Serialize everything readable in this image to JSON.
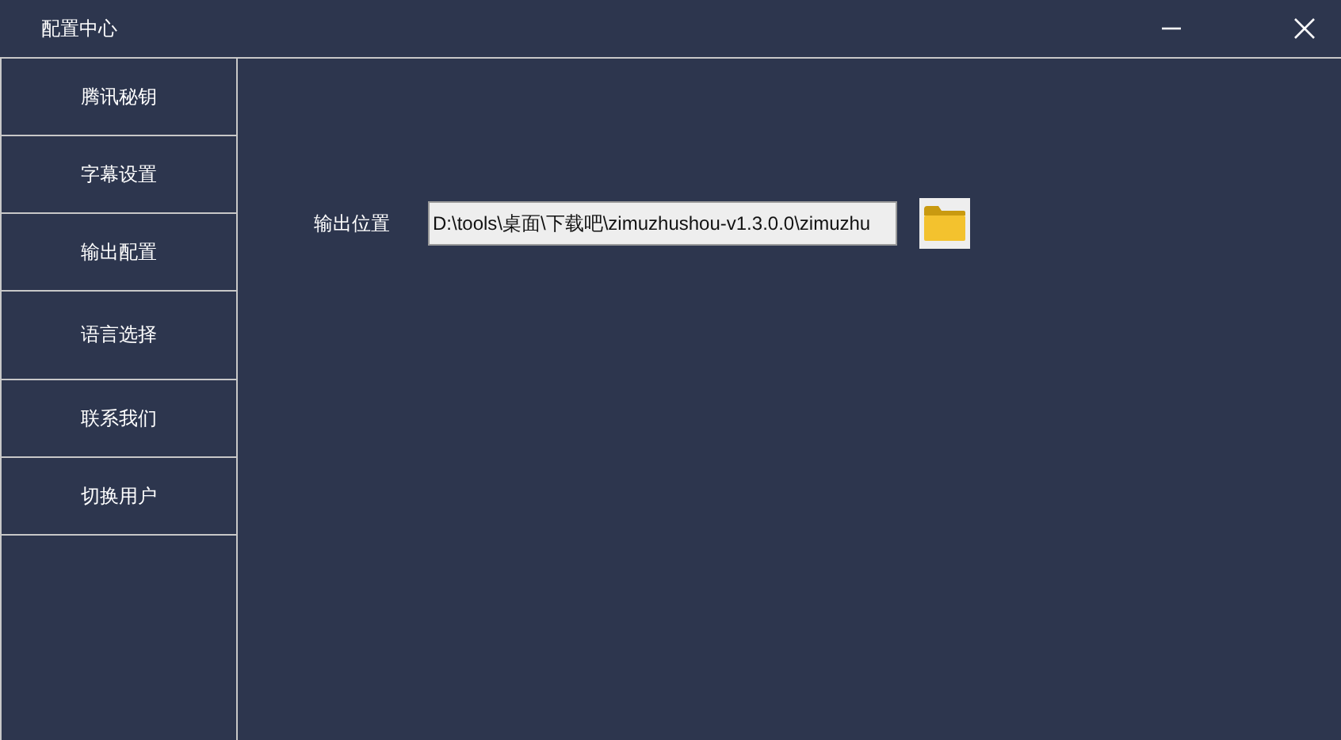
{
  "window": {
    "title": "配置中心",
    "controls": [
      {
        "kind": "minimize"
      },
      {
        "kind": "close"
      }
    ]
  },
  "sidebar": {
    "items": [
      {
        "label": "腾讯秘钥"
      },
      {
        "label": "字幕设置"
      },
      {
        "label": "输出配置"
      },
      {
        "label": "语言选择"
      },
      {
        "label": "联系我们"
      },
      {
        "label": "切换用户"
      }
    ]
  },
  "output": {
    "label": "输出位置",
    "value": "D:\\tools\\桌面\\下载吧\\zimuzhushou-v1.3.0.0\\zimuzhu"
  }
}
